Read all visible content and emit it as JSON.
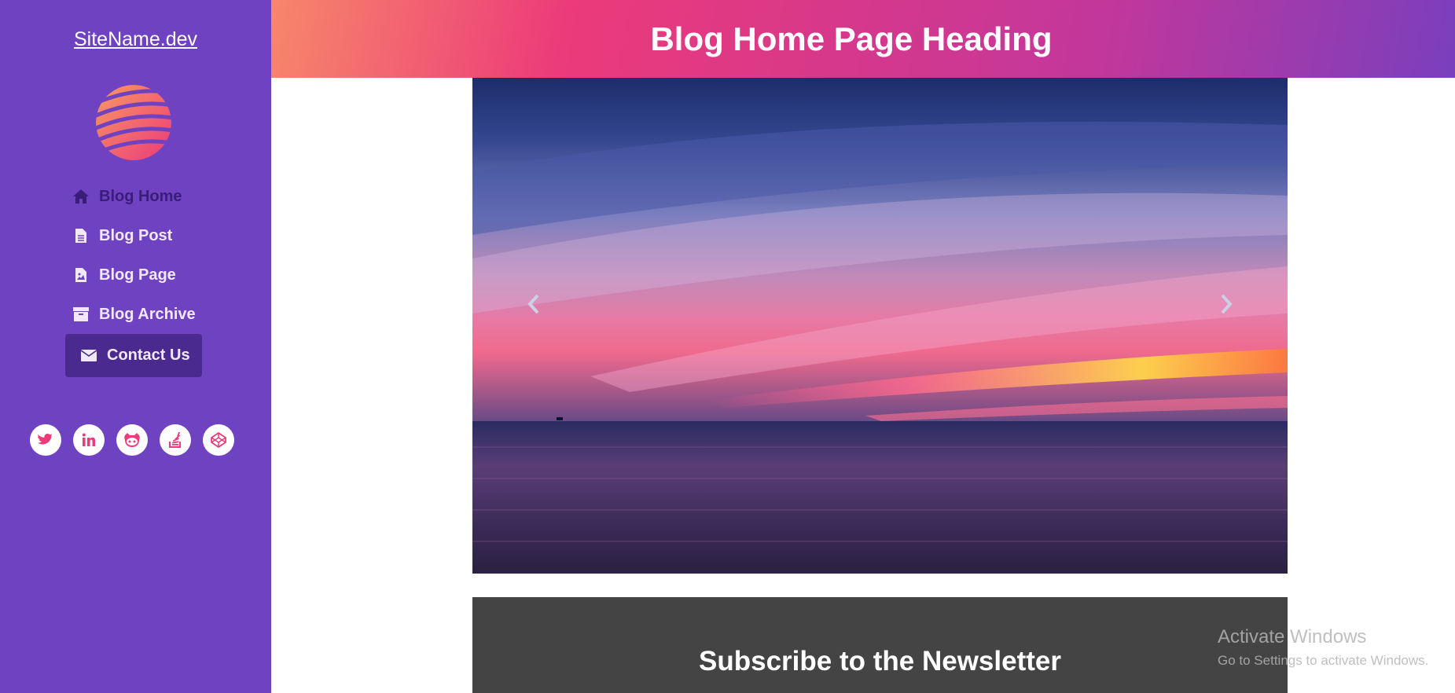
{
  "sidebar": {
    "site_name": "SiteName.dev",
    "nav": [
      {
        "label": "Blog Home",
        "icon": "home-icon"
      },
      {
        "label": "Blog Post",
        "icon": "file-icon"
      },
      {
        "label": "Blog Page",
        "icon": "file-image-icon"
      },
      {
        "label": "Blog Archive",
        "icon": "archive-icon"
      },
      {
        "label": "Contact Us",
        "icon": "envelope-icon"
      }
    ],
    "social": [
      "twitter-icon",
      "linkedin-icon",
      "github-icon",
      "stackoverflow-icon",
      "codepen-icon"
    ]
  },
  "header": {
    "title": "Blog Home Page Heading"
  },
  "newsletter": {
    "title": "Subscribe to the Newsletter"
  },
  "watermark": {
    "line1": "Activate Windows",
    "line2": "Go to Settings to activate Windows."
  },
  "colors": {
    "sidebar": "#6f42c1",
    "accent": "#ec3a7a",
    "newsletter_bg": "#444444"
  }
}
